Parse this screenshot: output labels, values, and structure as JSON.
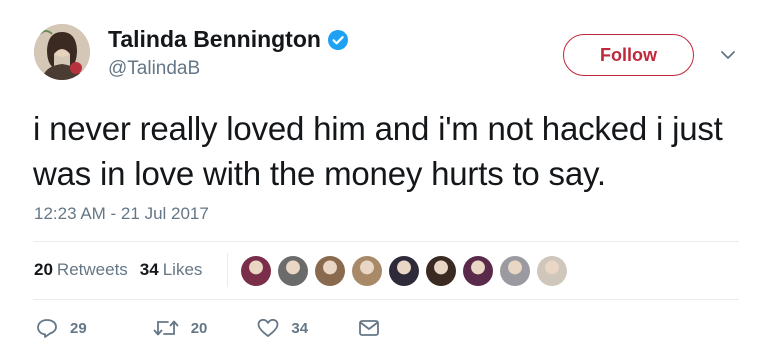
{
  "user": {
    "display_name": "Talinda Bennington",
    "handle": "@TalindaB",
    "verified_icon": "verified-badge-icon",
    "avatar": "profile-photo-avatar"
  },
  "follow_button": {
    "label": "Follow",
    "color": "#c0283b"
  },
  "tweet": {
    "text": "i never really loved him and i'm not hacked i just was in love with the money hurts to say.",
    "timestamp": "12:23 AM - 21 Jul 2017"
  },
  "stats": {
    "retweets_count": "20",
    "retweets_label": "Retweets",
    "likes_count": "34",
    "likes_label": "Likes"
  },
  "liker_avatars": [
    {
      "color": "#7a2e4a"
    },
    {
      "color": "#6b6b6b"
    },
    {
      "color": "#8a6a4f"
    },
    {
      "color": "#a88a68"
    },
    {
      "color": "#2e2a3a"
    },
    {
      "color": "#3a2a22"
    },
    {
      "color": "#5a2a4a"
    },
    {
      "color": "#9a9aa0"
    },
    {
      "color": "#cfc6bc"
    }
  ],
  "actions": {
    "reply_count": "29",
    "retweet_count": "20",
    "like_count": "34"
  },
  "colors": {
    "text": "#14171a",
    "secondary": "#657786",
    "verified": "#1da1f2",
    "divider": "#e6ecf0"
  }
}
